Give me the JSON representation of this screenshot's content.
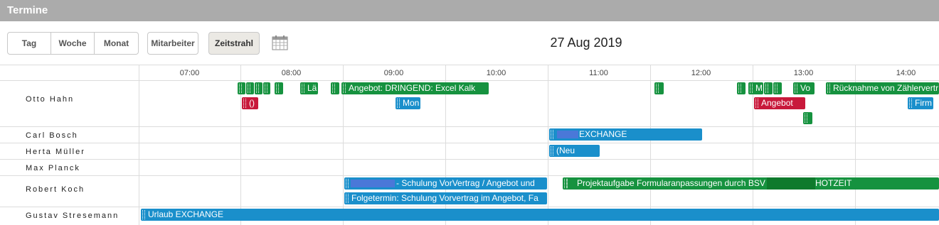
{
  "header": {
    "title": "Termine"
  },
  "toolbar": {
    "tag": "Tag",
    "woche": "Woche",
    "monat": "Monat",
    "mitarbeiter": "Mitarbeiter",
    "zeitstrahl": "Zeitstrahl",
    "date": "27 Aug 2019"
  },
  "timeline": {
    "hours": [
      "07:00",
      "08:00",
      "09:00",
      "10:00",
      "11:00",
      "12:00",
      "13:00",
      "14:00"
    ]
  },
  "people": [
    "Otto Hahn",
    "Carl Bosch",
    "Herta Müller",
    "Max Planck",
    "Robert Koch",
    "Gustav Stresemann"
  ],
  "events": {
    "otto_la": "Lä",
    "otto_angebot": "Angebot: DRINGEND: Excel Kalk",
    "otto_m": "M",
    "otto_vo": "Vo",
    "otto_ruecknahme": "Rücknahme von Zählervertr",
    "otto_red_small": "()",
    "otto_mon": "Mon",
    "otto_angebot_red": "Angebot",
    "otto_firm": "Firm",
    "carl_exchange": "EXCHANGE",
    "herta_neu": "(Neu",
    "robert_schulung": "- Schulung VorVertrag / Angebot und",
    "robert_folge": "Folgetermin: Schulung Vorvertrag im Angebot, Fa",
    "robert_projekt": "Projektaufgabe Formularanpassungen durch BSV",
    "robert_hotzeit": "HOTZEIT",
    "gustav_urlaub": "Urlaub EXCHANGE"
  },
  "colors": {
    "green": "#16923f",
    "blue": "#1a8fcb",
    "red": "#c8193b",
    "header": "#ababab"
  },
  "icons": {
    "calendar": "calendar-icon"
  }
}
